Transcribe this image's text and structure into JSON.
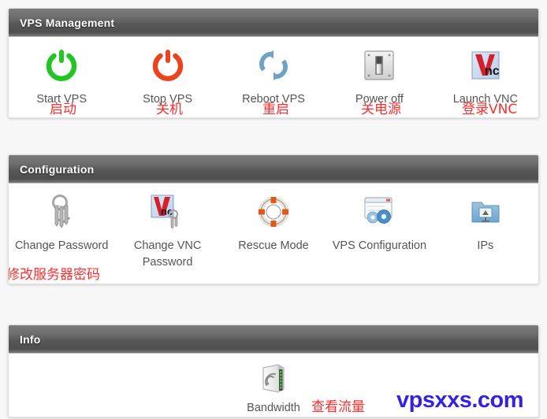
{
  "page": {
    "background_color": "#f7f7f7",
    "accent_red": "#ff2d2d",
    "watermark_color": "#3322e0"
  },
  "watermark": {
    "text": "vpsxxs.com"
  },
  "panels": [
    {
      "id": "vps-management",
      "title": "VPS Management",
      "items": [
        {
          "label": "Start VPS",
          "icon": "power-on-icon",
          "icon_color": "#22c522",
          "note": "启动"
        },
        {
          "label": "Stop VPS",
          "icon": "power-off-icon",
          "icon_color": "#e8451f",
          "note": "关机"
        },
        {
          "label": "Reboot VPS",
          "icon": "reboot-icon",
          "icon_color": "#6fa3c4",
          "note": "重启"
        },
        {
          "label": "Power off",
          "icon": "light-switch-icon",
          "icon_color": "#c9c9c9",
          "note": "关电源"
        },
        {
          "label": "Launch VNC",
          "icon": "vnc-logo-icon",
          "icon_color": "#d4202a",
          "note": "登录VNC"
        }
      ]
    },
    {
      "id": "configuration",
      "title": "Configuration",
      "items": [
        {
          "label": "Change Password",
          "icon": "keyring-icon",
          "icon_color": "#9a9a9a",
          "note": "修改服务器密码"
        },
        {
          "label": "Change VNC Password",
          "icon": "vnc-keyring-icon",
          "icon_color": "#d4202a",
          "note": ""
        },
        {
          "label": "Rescue Mode",
          "icon": "lifebuoy-icon",
          "icon_color": "#e05a17",
          "note": ""
        },
        {
          "label": "VPS Configuration",
          "icon": "window-gears-icon",
          "icon_color": "#4a90c4",
          "note": ""
        },
        {
          "label": "IPs",
          "icon": "network-folder-icon",
          "icon_color": "#7db3d8",
          "note": ""
        }
      ]
    },
    {
      "id": "info",
      "title": "Info",
      "items": [
        {
          "label": "Bandwidth",
          "icon": "bandwidth-router-icon",
          "icon_color": "#cfcfcf",
          "note": "查看流量"
        }
      ]
    }
  ]
}
